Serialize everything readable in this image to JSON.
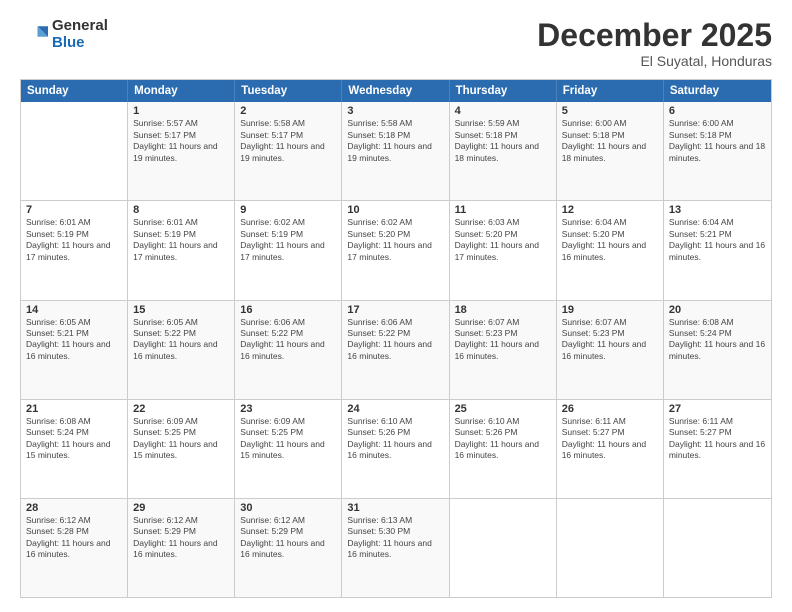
{
  "logo": {
    "general": "General",
    "blue": "Blue"
  },
  "title": "December 2025",
  "subtitle": "El Suyatal, Honduras",
  "header_days": [
    "Sunday",
    "Monday",
    "Tuesday",
    "Wednesday",
    "Thursday",
    "Friday",
    "Saturday"
  ],
  "rows": [
    {
      "cells": [
        {
          "empty": true
        },
        {
          "day": "1",
          "sunrise": "5:57 AM",
          "sunset": "5:17 PM",
          "daylight": "11 hours and 19 minutes."
        },
        {
          "day": "2",
          "sunrise": "5:58 AM",
          "sunset": "5:17 PM",
          "daylight": "11 hours and 19 minutes."
        },
        {
          "day": "3",
          "sunrise": "5:58 AM",
          "sunset": "5:18 PM",
          "daylight": "11 hours and 19 minutes."
        },
        {
          "day": "4",
          "sunrise": "5:59 AM",
          "sunset": "5:18 PM",
          "daylight": "11 hours and 18 minutes."
        },
        {
          "day": "5",
          "sunrise": "6:00 AM",
          "sunset": "5:18 PM",
          "daylight": "11 hours and 18 minutes."
        },
        {
          "day": "6",
          "sunrise": "6:00 AM",
          "sunset": "5:18 PM",
          "daylight": "11 hours and 18 minutes."
        }
      ]
    },
    {
      "cells": [
        {
          "day": "7",
          "sunrise": "6:01 AM",
          "sunset": "5:19 PM",
          "daylight": "11 hours and 17 minutes."
        },
        {
          "day": "8",
          "sunrise": "6:01 AM",
          "sunset": "5:19 PM",
          "daylight": "11 hours and 17 minutes."
        },
        {
          "day": "9",
          "sunrise": "6:02 AM",
          "sunset": "5:19 PM",
          "daylight": "11 hours and 17 minutes."
        },
        {
          "day": "10",
          "sunrise": "6:02 AM",
          "sunset": "5:20 PM",
          "daylight": "11 hours and 17 minutes."
        },
        {
          "day": "11",
          "sunrise": "6:03 AM",
          "sunset": "5:20 PM",
          "daylight": "11 hours and 17 minutes."
        },
        {
          "day": "12",
          "sunrise": "6:04 AM",
          "sunset": "5:20 PM",
          "daylight": "11 hours and 16 minutes."
        },
        {
          "day": "13",
          "sunrise": "6:04 AM",
          "sunset": "5:21 PM",
          "daylight": "11 hours and 16 minutes."
        }
      ]
    },
    {
      "cells": [
        {
          "day": "14",
          "sunrise": "6:05 AM",
          "sunset": "5:21 PM",
          "daylight": "11 hours and 16 minutes."
        },
        {
          "day": "15",
          "sunrise": "6:05 AM",
          "sunset": "5:22 PM",
          "daylight": "11 hours and 16 minutes."
        },
        {
          "day": "16",
          "sunrise": "6:06 AM",
          "sunset": "5:22 PM",
          "daylight": "11 hours and 16 minutes."
        },
        {
          "day": "17",
          "sunrise": "6:06 AM",
          "sunset": "5:22 PM",
          "daylight": "11 hours and 16 minutes."
        },
        {
          "day": "18",
          "sunrise": "6:07 AM",
          "sunset": "5:23 PM",
          "daylight": "11 hours and 16 minutes."
        },
        {
          "day": "19",
          "sunrise": "6:07 AM",
          "sunset": "5:23 PM",
          "daylight": "11 hours and 16 minutes."
        },
        {
          "day": "20",
          "sunrise": "6:08 AM",
          "sunset": "5:24 PM",
          "daylight": "11 hours and 16 minutes."
        }
      ]
    },
    {
      "cells": [
        {
          "day": "21",
          "sunrise": "6:08 AM",
          "sunset": "5:24 PM",
          "daylight": "11 hours and 15 minutes."
        },
        {
          "day": "22",
          "sunrise": "6:09 AM",
          "sunset": "5:25 PM",
          "daylight": "11 hours and 15 minutes."
        },
        {
          "day": "23",
          "sunrise": "6:09 AM",
          "sunset": "5:25 PM",
          "daylight": "11 hours and 15 minutes."
        },
        {
          "day": "24",
          "sunrise": "6:10 AM",
          "sunset": "5:26 PM",
          "daylight": "11 hours and 16 minutes."
        },
        {
          "day": "25",
          "sunrise": "6:10 AM",
          "sunset": "5:26 PM",
          "daylight": "11 hours and 16 minutes."
        },
        {
          "day": "26",
          "sunrise": "6:11 AM",
          "sunset": "5:27 PM",
          "daylight": "11 hours and 16 minutes."
        },
        {
          "day": "27",
          "sunrise": "6:11 AM",
          "sunset": "5:27 PM",
          "daylight": "11 hours and 16 minutes."
        }
      ]
    },
    {
      "cells": [
        {
          "day": "28",
          "sunrise": "6:12 AM",
          "sunset": "5:28 PM",
          "daylight": "11 hours and 16 minutes."
        },
        {
          "day": "29",
          "sunrise": "6:12 AM",
          "sunset": "5:29 PM",
          "daylight": "11 hours and 16 minutes."
        },
        {
          "day": "30",
          "sunrise": "6:12 AM",
          "sunset": "5:29 PM",
          "daylight": "11 hours and 16 minutes."
        },
        {
          "day": "31",
          "sunrise": "6:13 AM",
          "sunset": "5:30 PM",
          "daylight": "11 hours and 16 minutes."
        },
        {
          "empty": true
        },
        {
          "empty": true
        },
        {
          "empty": true
        }
      ]
    }
  ]
}
